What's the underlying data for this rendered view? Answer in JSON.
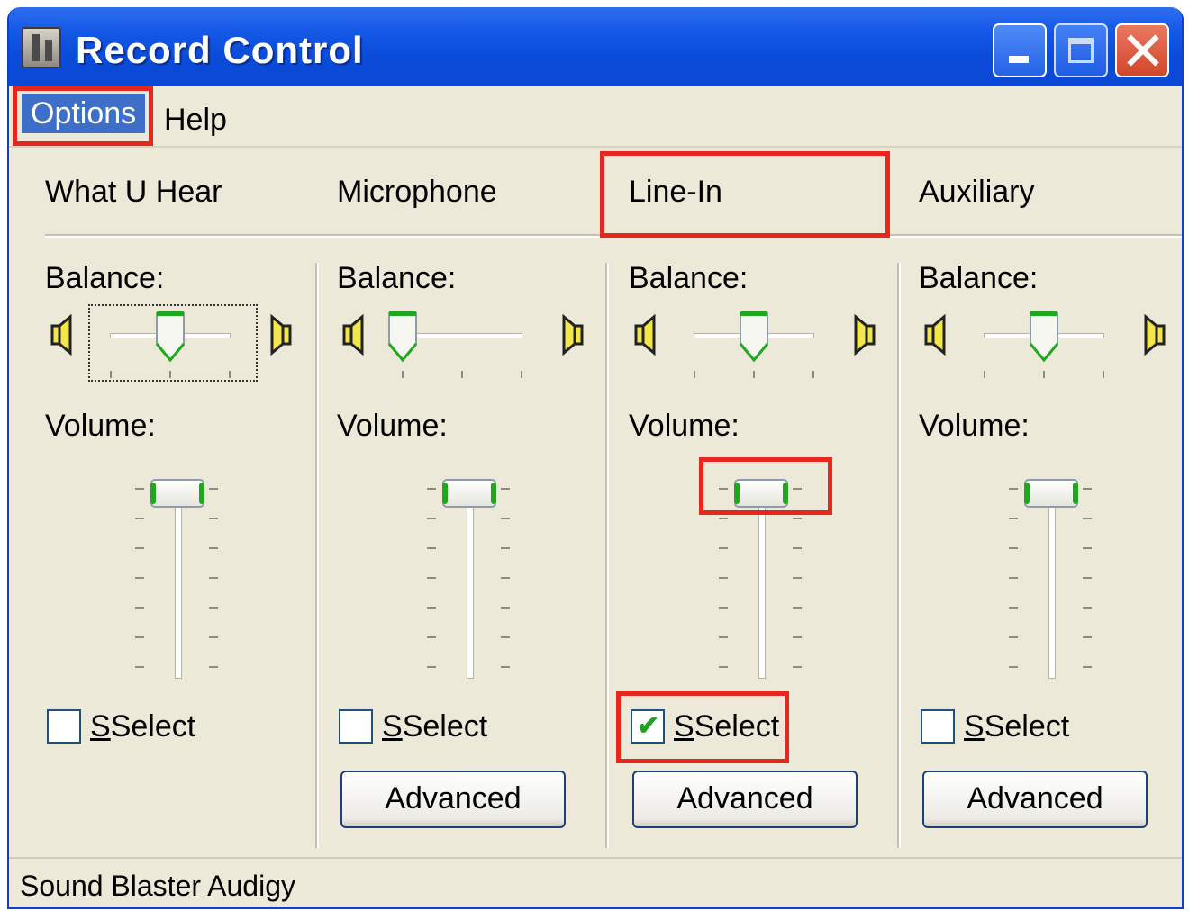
{
  "window": {
    "title": "Record Control"
  },
  "menu": {
    "options": "Options",
    "help": "Help"
  },
  "columns": [
    {
      "name": "What U Hear",
      "balance_label": "Balance:",
      "volume_label": "Volume:",
      "select_label": "Select",
      "selected": false,
      "advanced": ""
    },
    {
      "name": "Microphone",
      "balance_label": "Balance:",
      "volume_label": "Volume:",
      "select_label": "Select",
      "selected": false,
      "advanced": "Advanced"
    },
    {
      "name": "Line-In",
      "balance_label": "Balance:",
      "volume_label": "Volume:",
      "select_label": "Select",
      "selected": true,
      "advanced": "Advanced"
    },
    {
      "name": "Auxiliary",
      "balance_label": "Balance:",
      "volume_label": "Volume:",
      "select_label": "Select",
      "selected": false,
      "advanced": "Advanced"
    }
  ],
  "levels": {
    "balance": [
      0.5,
      0.0,
      0.5,
      0.5
    ],
    "volume": [
      1.0,
      1.0,
      1.0,
      1.0
    ]
  },
  "status": {
    "text": "Sound Blaster Audigy"
  },
  "colors": {
    "highlight_box": "#e8261c",
    "title_bar": "#0a4bd9",
    "window_bg": "#ece9d8"
  }
}
